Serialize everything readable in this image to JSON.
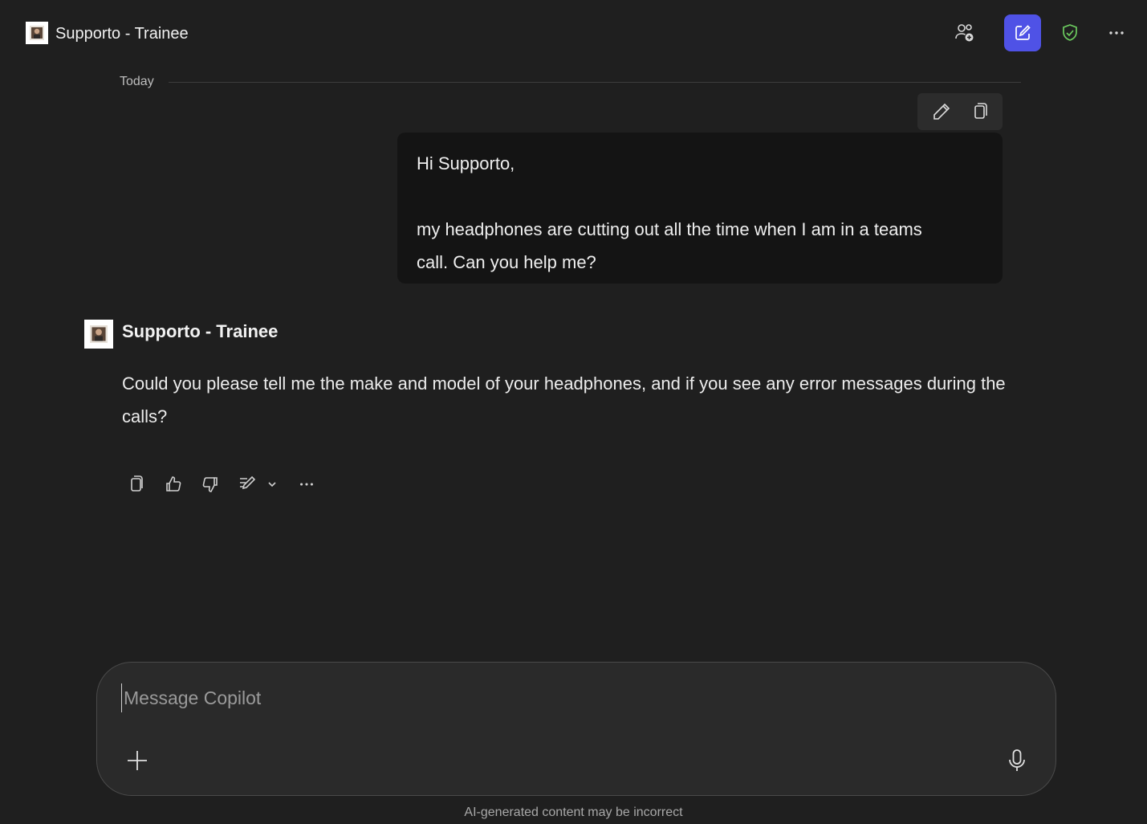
{
  "header": {
    "title": "Supporto - Trainee",
    "icons": [
      "people-add-icon",
      "compose-icon",
      "shield-check-icon",
      "more-icon"
    ],
    "accent_color": "#4f52e6",
    "shield_color": "#6ccb5f"
  },
  "conversation": {
    "date_divider": "Today",
    "user_message": {
      "line1": "Hi Supporto,",
      "line2": "my headphones are cutting out all the time when I am in a teams",
      "line3": "call. Can you help me?",
      "tools": [
        "edit-icon",
        "copy-icon"
      ]
    },
    "bot_message": {
      "name": "Supporto - Trainee",
      "text": "Could you please tell me the make and model of your headphones, and if you see any error messages during the calls?",
      "actions": [
        "copy-icon",
        "thumbs-up-icon",
        "thumbs-down-icon",
        "edit-draft-icon",
        "chevron-down-icon",
        "more-icon"
      ]
    }
  },
  "composer": {
    "placeholder": "Message Copilot",
    "icons": [
      "plus-icon",
      "microphone-icon"
    ]
  },
  "footer": {
    "disclaimer": "AI-generated content may be incorrect"
  }
}
